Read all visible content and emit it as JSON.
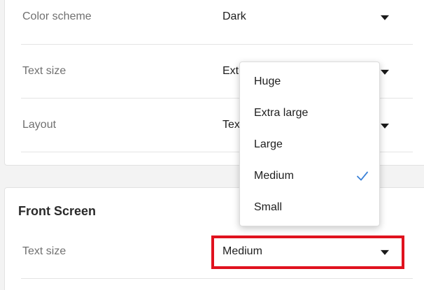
{
  "display_settings": {
    "rows": [
      {
        "label": "Color scheme",
        "value": "Dark"
      },
      {
        "label": "Text size",
        "value": "Extra large"
      },
      {
        "label": "Layout",
        "value": "Text only"
      }
    ]
  },
  "text_size_menu": {
    "options": [
      {
        "label": "Huge",
        "selected": false
      },
      {
        "label": "Extra large",
        "selected": false
      },
      {
        "label": "Large",
        "selected": false
      },
      {
        "label": "Medium",
        "selected": true
      },
      {
        "label": "Small",
        "selected": false
      }
    ],
    "check_icon": "checkmark-icon",
    "check_color": "#3b82d8"
  },
  "front_screen": {
    "title": "Front Screen",
    "text_size_label": "Text size",
    "text_size_value": "Medium",
    "highlight_color": "#e0121e"
  },
  "icons": {
    "dropdown_caret": "caret-down-icon"
  }
}
